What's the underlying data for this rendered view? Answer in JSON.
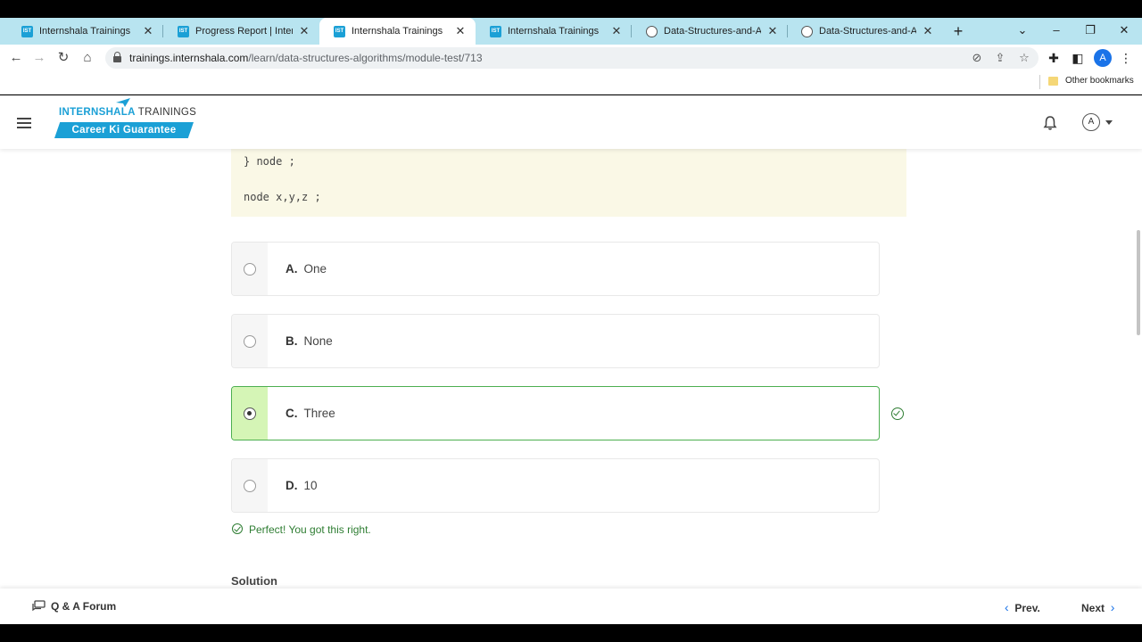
{
  "browser": {
    "tabs": [
      {
        "title": "Internshala Trainings",
        "favicon": "IST",
        "active": false
      },
      {
        "title": "Progress Report | Internshala",
        "favicon": "IST",
        "active": false
      },
      {
        "title": "Internshala Trainings",
        "favicon": "IST",
        "active": true
      },
      {
        "title": "Internshala Trainings",
        "favicon": "IST",
        "active": false
      },
      {
        "title": "Data-Structures-and-Algorithms",
        "favicon": "github-icon",
        "active": false
      },
      {
        "title": "Data-Structures-and-Algorithms",
        "favicon": "github-icon",
        "active": false
      }
    ],
    "url_domain": "trainings.internshala.com",
    "url_path": "/learn/data-structures-algorithms/module-test/713",
    "profile_initial": "A",
    "bookmarks": {
      "other_label": "Other bookmarks"
    }
  },
  "header": {
    "logo_brand": "INTERNSHALA",
    "logo_suffix": "TRAININGS",
    "tagline": "Career Ki Guarantee",
    "avatar_initial": "A"
  },
  "question": {
    "code_lines": [
      "} node ;",
      "node x,y,z ;"
    ],
    "options": [
      {
        "letter": "A.",
        "text": "One",
        "state": "unselected"
      },
      {
        "letter": "B.",
        "text": "None",
        "state": "unselected"
      },
      {
        "letter": "C.",
        "text": "Three",
        "state": "selected-correct"
      },
      {
        "letter": "D.",
        "text": "10",
        "state": "unselected"
      }
    ],
    "feedback": "Perfect! You got this right.",
    "solution_heading": "Solution"
  },
  "footer": {
    "qa_label": "Q & A Forum",
    "prev_label": "Prev.",
    "next_label": "Next"
  },
  "colors": {
    "brand": "#1ba0d6",
    "correct_green": "#2e7d32",
    "correct_fill": "#d5f5b6",
    "tabbar": "#b8e4f0",
    "code_bg": "#faf8e6"
  }
}
